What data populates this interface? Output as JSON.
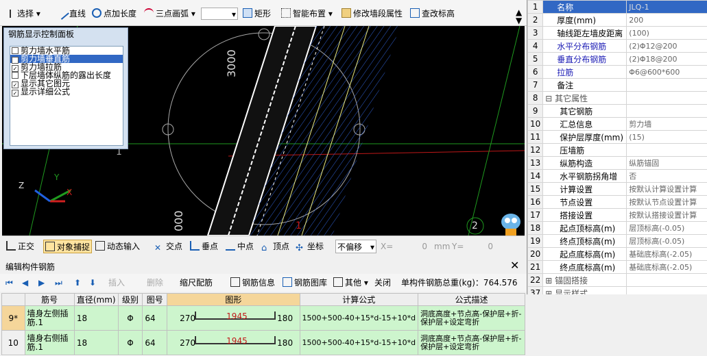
{
  "toolbar": {
    "select": "选择",
    "line": "直线",
    "point_length": "点加长度",
    "three_point_arc": "三点画弧",
    "rect": "矩形",
    "smart_layout": "智能布置",
    "modify_segment": "修改墙段属性",
    "check_elevation": "查改标高"
  },
  "canvas": {
    "label_top": "3000",
    "label_bottom": "000",
    "label_side": "1",
    "axis_x": "X",
    "axis_y": "Y",
    "axis_z": "Z",
    "marker_1": "1",
    "marker_2": "2"
  },
  "control_panel": {
    "title": "钢筋显示控制面板",
    "items": [
      {
        "label": "剪力墙水平筋",
        "checked": false,
        "selected": false
      },
      {
        "label": "剪力墙垂直筋",
        "checked": true,
        "selected": true
      },
      {
        "label": "剪力墙拉筋",
        "checked": true,
        "selected": false
      },
      {
        "label": "下层墙体纵筋的露出长度",
        "checked": false,
        "selected": false
      },
      {
        "label": "显示其它图元",
        "checked": true,
        "selected": false
      },
      {
        "label": "显示详细公式",
        "checked": true,
        "selected": false
      }
    ]
  },
  "status": {
    "ortho": "正交",
    "snap": "对象捕捉",
    "dyn": "动态输入",
    "intersect": "交点",
    "perp": "垂点",
    "mid": "中点",
    "vertex": "顶点",
    "coord": "坐标",
    "offset_mode": "不偏移",
    "x_label": "X=",
    "x_val": "0",
    "unit": "mm",
    "y_label": "Y=",
    "y_val": "0"
  },
  "edit_panel": {
    "title": "编辑构件钢筋",
    "insert": "插入",
    "delete": "删除",
    "scale": "缩尺配筋",
    "info": "钢筋信息",
    "library": "钢筋图库",
    "other": "其他",
    "close": "关闭",
    "total": "单构件钢筋总重(kg)：764.576"
  },
  "grid": {
    "headers": [
      "",
      "筋号",
      "直径(mm)",
      "级别",
      "图号",
      "图形",
      "计算公式",
      "公式描述"
    ],
    "rows": [
      {
        "idx": "9*",
        "name": "墙身左侧插筋.1",
        "dia": "18",
        "grade": "Φ",
        "fig": "64",
        "left": "270",
        "mid": "1945",
        "right": "180",
        "formula": "1500+500-40+15*d-15+10*d",
        "desc": "洞底高度+节点高-保护层+折-保护层+设定弯折"
      },
      {
        "idx": "10",
        "name": "墙身右侧插筋.1",
        "dia": "18",
        "grade": "Φ",
        "fig": "64",
        "left": "270",
        "mid": "1945",
        "right": "180",
        "formula": "1500+500-40+15*d-15+10*d",
        "desc": "洞底高度+节点高-保护层+折-保护层+设定弯折"
      }
    ]
  },
  "props": [
    {
      "n": "1",
      "name": "名称",
      "val": "JLQ-1",
      "blue": false
    },
    {
      "n": "2",
      "name": "厚度(mm)",
      "val": "200",
      "blue": false
    },
    {
      "n": "3",
      "name": "轴线距左墙皮距离",
      "val": "(100)",
      "blue": false
    },
    {
      "n": "4",
      "name": "水平分布钢筋",
      "val": "(2)Φ12@200",
      "blue": true
    },
    {
      "n": "5",
      "name": "垂直分布钢筋",
      "val": "(2)Φ18@200",
      "blue": true
    },
    {
      "n": "6",
      "name": "拉筋",
      "val": "Φ6@600*600",
      "blue": true
    },
    {
      "n": "7",
      "name": "备注",
      "val": "",
      "blue": false
    },
    {
      "n": "8",
      "name": "其它属性",
      "val": "",
      "blue": false
    },
    {
      "n": "9",
      "name": "其它钢筋",
      "val": "",
      "blue": false
    },
    {
      "n": "10",
      "name": "汇总信息",
      "val": "剪力墙",
      "blue": false
    },
    {
      "n": "11",
      "name": "保护层厚度(mm)",
      "val": "(15)",
      "blue": false
    },
    {
      "n": "12",
      "name": "压墙筋",
      "val": "",
      "blue": false
    },
    {
      "n": "13",
      "name": "纵筋构造",
      "val": "纵筋锚固",
      "blue": false
    },
    {
      "n": "14",
      "name": "水平钢筋拐角增",
      "val": "否",
      "blue": false
    },
    {
      "n": "15",
      "name": "计算设置",
      "val": "按默认计算设置计算",
      "blue": false
    },
    {
      "n": "16",
      "name": "节点设置",
      "val": "按默认节点设置计算",
      "blue": false
    },
    {
      "n": "17",
      "name": "搭接设置",
      "val": "按默认搭接设置计算",
      "blue": false
    },
    {
      "n": "18",
      "name": "起点顶标高(m)",
      "val": "层顶标高(-0.05)",
      "blue": false
    },
    {
      "n": "19",
      "name": "终点顶标高(m)",
      "val": "层顶标高(-0.05)",
      "blue": false
    },
    {
      "n": "20",
      "name": "起点底标高(m)",
      "val": "基础底标高(-2.05)",
      "blue": false
    },
    {
      "n": "21",
      "name": "终点底标高(m)",
      "val": "基础底标高(-2.05)",
      "blue": false
    },
    {
      "n": "22",
      "name": "锚固搭接",
      "val": "",
      "blue": false
    },
    {
      "n": "37",
      "name": "显示样式",
      "val": "",
      "blue": false
    }
  ]
}
